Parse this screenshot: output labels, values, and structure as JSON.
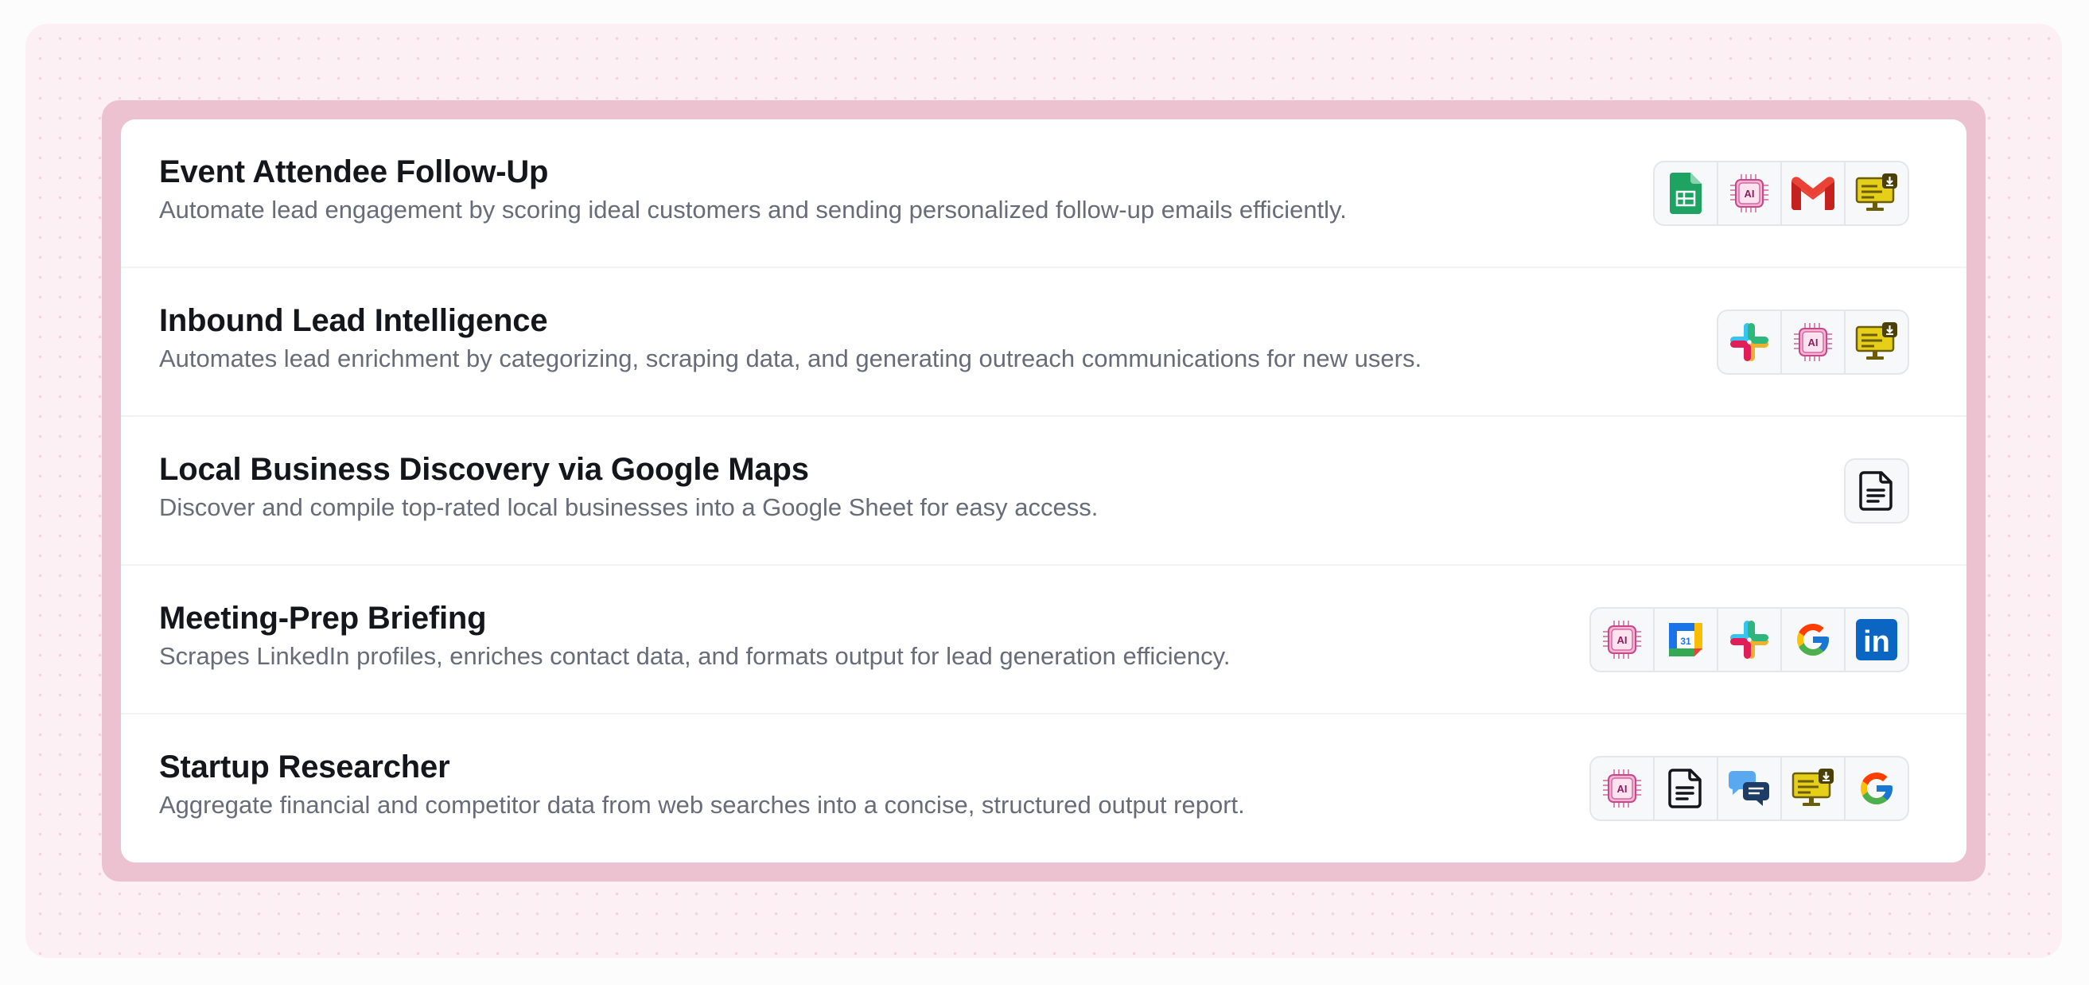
{
  "workflows": [
    {
      "title": "Event Attendee Follow-Up",
      "description": "Automate lead engagement by scoring ideal customers and sending personalized follow-up emails efficiently.",
      "icons": [
        "google-sheets-icon",
        "ai-chip-icon",
        "gmail-icon",
        "monitor-download-icon"
      ]
    },
    {
      "title": "Inbound Lead Intelligence",
      "description": "Automates lead enrichment by categorizing, scraping data, and generating outreach communications for new users.",
      "icons": [
        "slack-icon",
        "ai-chip-icon",
        "monitor-download-icon"
      ]
    },
    {
      "title": "Local Business Discovery via Google Maps",
      "description": "Discover and compile top-rated local businesses into a Google Sheet for easy access.",
      "icons": [
        "document-icon"
      ]
    },
    {
      "title": "Meeting-Prep Briefing",
      "description": "Scrapes LinkedIn profiles, enriches contact data, and formats output for lead generation efficiency.",
      "icons": [
        "ai-chip-icon",
        "google-calendar-icon",
        "slack-icon",
        "google-icon",
        "linkedin-icon"
      ]
    },
    {
      "title": "Startup Researcher",
      "description": "Aggregate financial and competitor data from web searches into a concise, structured output report.",
      "icons": [
        "ai-chip-icon",
        "document-icon",
        "chat-bubbles-icon",
        "monitor-download-icon",
        "google-icon"
      ]
    }
  ],
  "ai_chip_label": "AI",
  "calendar_day": "31",
  "linkedin_label": "in",
  "colors": {
    "outer_bg": "#fdf0f5",
    "frame": "#ecc2d1",
    "title": "#14161b",
    "description": "#676c78"
  }
}
